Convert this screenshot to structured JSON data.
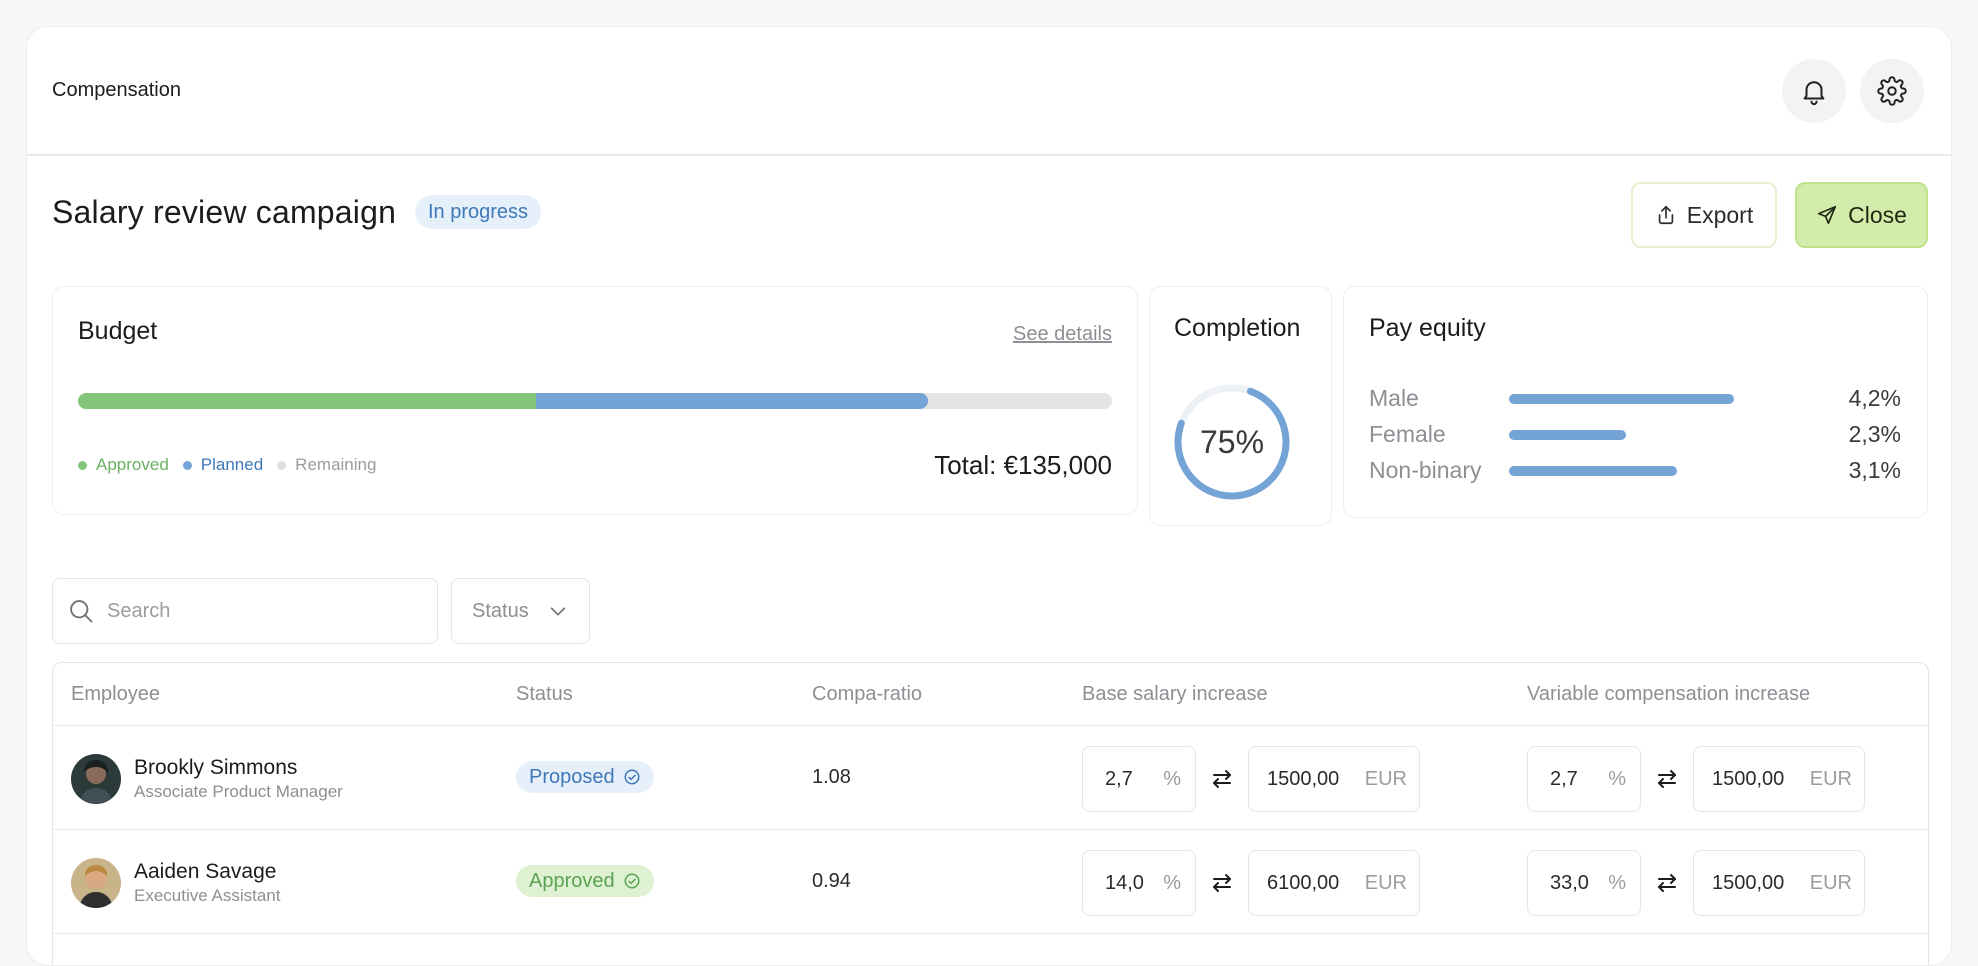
{
  "app": {
    "title": "Compensation"
  },
  "header": {
    "title": "Salary review campaign",
    "status": "In progress",
    "export_label": "Export",
    "close_label": "Close"
  },
  "budget": {
    "title": "Budget",
    "see_details": "See details",
    "approved_fraction": 0.443,
    "planned_fraction": 0.379,
    "legend": {
      "approved": "Approved",
      "planned": "Planned",
      "remaining": "Remaining"
    },
    "total": "Total: €135,000",
    "colors": {
      "approved": "#84c57c",
      "planned": "#74a3d6",
      "remaining": "#e4e4e4"
    }
  },
  "completion": {
    "title": "Completion",
    "value_label": "75%",
    "fraction": 0.75
  },
  "pay_equity": {
    "title": "Pay equity",
    "rows": [
      {
        "label": "Male",
        "value": "4,2%",
        "fraction": 1.0
      },
      {
        "label": "Female",
        "value": "2,3%",
        "fraction": 0.52
      },
      {
        "label": "Non-binary",
        "value": "3,1%",
        "fraction": 0.75
      }
    ]
  },
  "filters": {
    "search_placeholder": "Search",
    "status_label": "Status"
  },
  "table": {
    "columns": [
      "Employee",
      "Status",
      "Compa-ratio",
      "Base salary increase",
      "Variable compensation increase"
    ],
    "rows": [
      {
        "name": "Brookly Simmons",
        "role": "Associate Product Manager",
        "status": "Proposed",
        "compa_ratio": "1.08",
        "base_pct": "2,7",
        "base_pct_unit": "%",
        "base_amount": "1500,00",
        "base_currency": "EUR",
        "var_pct": "2,7",
        "var_pct_unit": "%",
        "var_amount": "1500,00",
        "var_currency": "EUR"
      },
      {
        "name": "Aaiden Savage",
        "role": "Executive Assistant",
        "status": "Approved",
        "compa_ratio": "0.94",
        "base_pct": "14,0",
        "base_pct_unit": "%",
        "base_amount": "6100,00",
        "base_currency": "EUR",
        "var_pct": "33,0",
        "var_pct_unit": "%",
        "var_amount": "1500,00",
        "var_currency": "EUR"
      }
    ]
  }
}
